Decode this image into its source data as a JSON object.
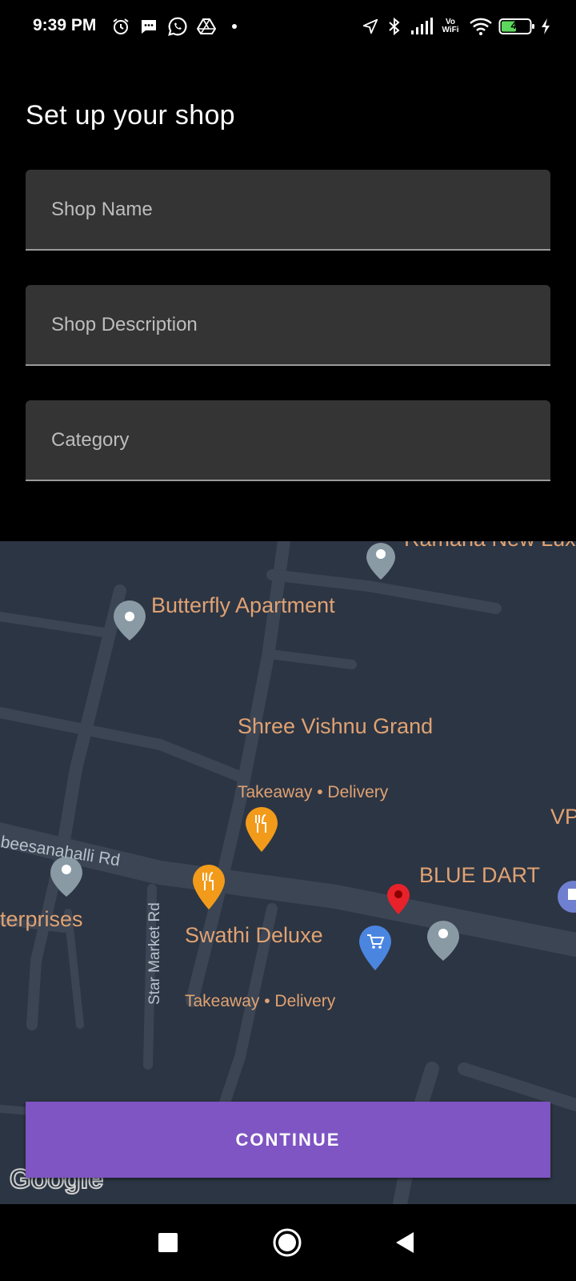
{
  "status_bar": {
    "time": "9:39 PM",
    "battery": "47",
    "left_icons": [
      "alarm-icon",
      "message-icon",
      "whatsapp-icon",
      "drive-icon",
      "dot-icon"
    ],
    "right_icons": [
      "location-arrow-icon",
      "bluetooth-icon",
      "signal-icon",
      "vowifi-icon",
      "wifi-icon",
      "battery-icon",
      "charging-icon"
    ]
  },
  "page": {
    "title": "Set up your shop"
  },
  "form": {
    "shop_name_placeholder": "Shop Name",
    "shop_description_placeholder": "Shop Description",
    "category_placeholder": "Category"
  },
  "map": {
    "labels": {
      "ramana": "Ramana New Luxe",
      "butterfly": "Butterfly Apartment",
      "shree": "Shree Vishnu Grand",
      "shree_sub": "Takeaway • Delivery",
      "vp": "VP",
      "road": "beesanahalli Rd",
      "blue_dart": "BLUE DART",
      "enterprises": "terprises",
      "swathi": "Swathi Deluxe",
      "star_market": "Star Market Rd",
      "swathi_sub": "Takeaway • Delivery",
      "google": "Google"
    },
    "colors": {
      "background": "#2c3543",
      "road": "#3b4554",
      "label": "#e0a273",
      "pin_gray": "#8a9aa4",
      "pin_orange": "#f29b1a",
      "pin_red": "#e8222a",
      "pin_blue": "#4a86e0"
    }
  },
  "actions": {
    "continue_label": "CONTINUE"
  },
  "nav": {
    "icons": [
      "recents-square-icon",
      "home-circle-icon",
      "back-triangle-icon"
    ]
  }
}
